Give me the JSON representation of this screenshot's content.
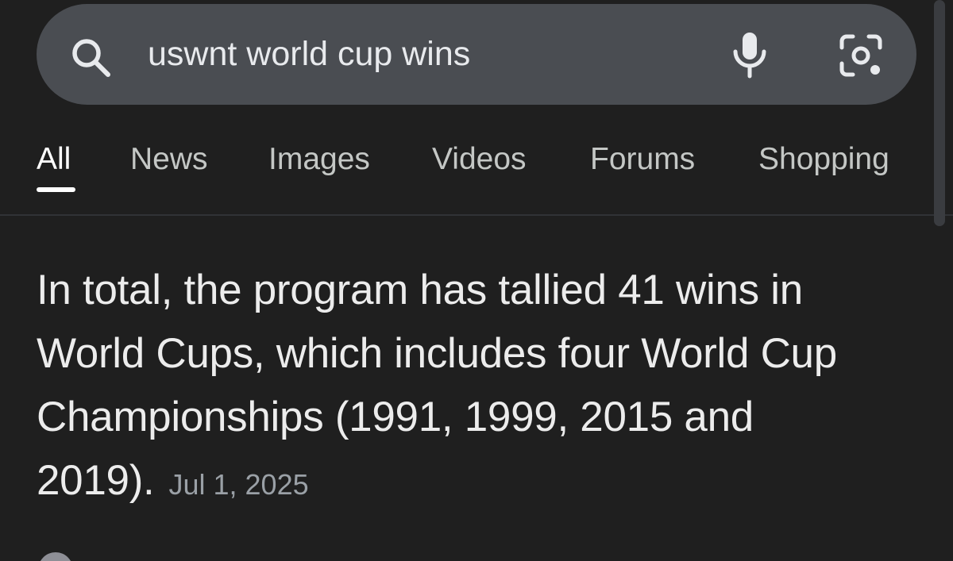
{
  "search": {
    "query": "uswnt world cup wins",
    "icons": {
      "search": "search-icon",
      "mic": "microphone-icon",
      "lens": "camera-lens-icon"
    }
  },
  "tabs": [
    {
      "label": "All",
      "active": true
    },
    {
      "label": "News",
      "active": false
    },
    {
      "label": "Images",
      "active": false
    },
    {
      "label": "Videos",
      "active": false
    },
    {
      "label": "Forums",
      "active": false
    },
    {
      "label": "Shopping",
      "active": false
    }
  ],
  "answer": {
    "text": "In total, the program has tallied 41 wins in World Cups, which includes four World Cup Championships (1991, 1999, 2015 and 2019).",
    "date": "Jul 1, 2025"
  },
  "colors": {
    "background": "#1f1f1f",
    "search_bar": "#4a4d52",
    "text": "#e8eaed",
    "muted": "#9aa0a6"
  }
}
